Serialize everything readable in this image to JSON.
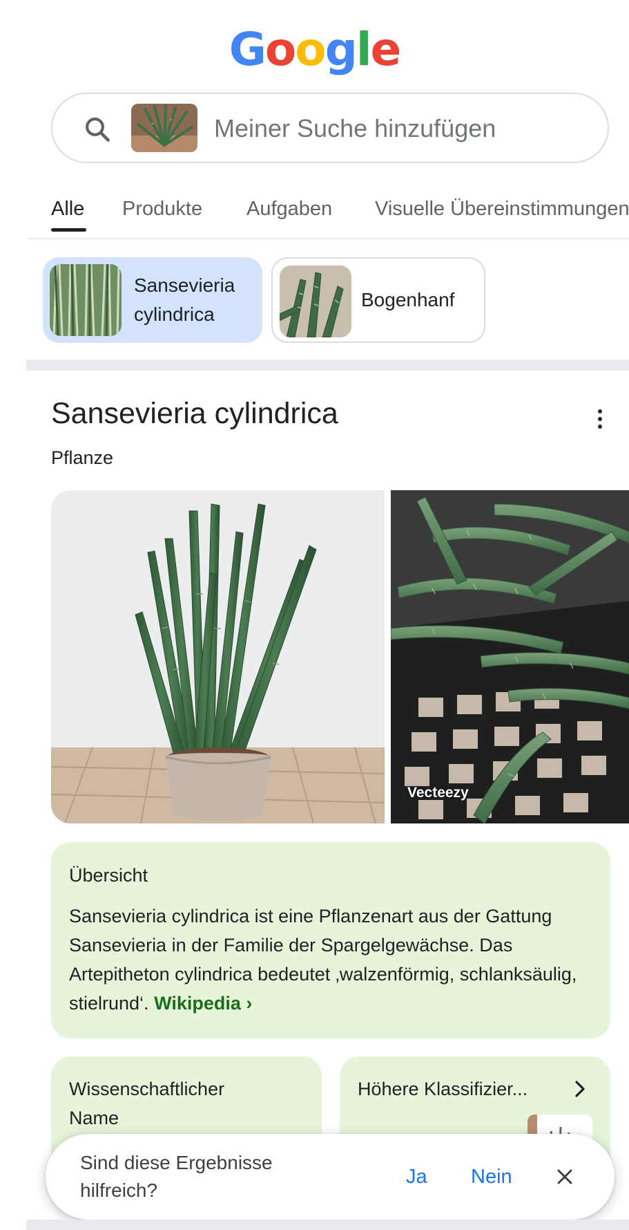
{
  "logo": {
    "letters": [
      "G",
      "o",
      "o",
      "g",
      "l",
      "e"
    ],
    "colors": [
      "#4285F4",
      "#EA4335",
      "#FBBC05",
      "#4285F4",
      "#34A853",
      "#EA4335"
    ]
  },
  "search": {
    "placeholder": "Meiner Suche hinzufügen",
    "icon": "search-icon"
  },
  "tabs": [
    {
      "label": "Alle",
      "active": true
    },
    {
      "label": "Produkte",
      "active": false
    },
    {
      "label": "Aufgaben",
      "active": false
    },
    {
      "label": "Visuelle Übereinstimmungen",
      "active": false
    }
  ],
  "chips": [
    {
      "label_line1": "Sansevieria",
      "label_line2": "cylindrica",
      "selected": true
    },
    {
      "label": "Bogenhanf",
      "selected": false
    }
  ],
  "knowledge_panel": {
    "title": "Sansevieria cylindrica",
    "subtitle": "Pflanze",
    "image_credit": "Vecteezy",
    "overview": {
      "heading": "Übersicht",
      "body": "Sansevieria cylindrica ist eine Pflanzenart aus der Gattung Sansevieria in der Familie der Spargelgewächse. Das Artepitheton cylindrica bedeutet ‚walzenförmig, schlanksäulig, stielrund‘.",
      "link_label": "Wikipedia ›"
    },
    "facts": [
      {
        "label_line1": "Wissenschaftlicher",
        "label_line2": "Name"
      },
      {
        "label": "Höhere Klassifizier..."
      }
    ]
  },
  "feedback": {
    "question_line1": "Sind diese Ergebnisse",
    "question_line2": "hilfreich?",
    "yes": "Ja",
    "no": "Nein"
  },
  "colors": {
    "accent_blue": "#1a73e8",
    "chip_selected": "#d3e3fd",
    "card_green": "#e6f4d9",
    "link_green": "#1a6e1a"
  }
}
